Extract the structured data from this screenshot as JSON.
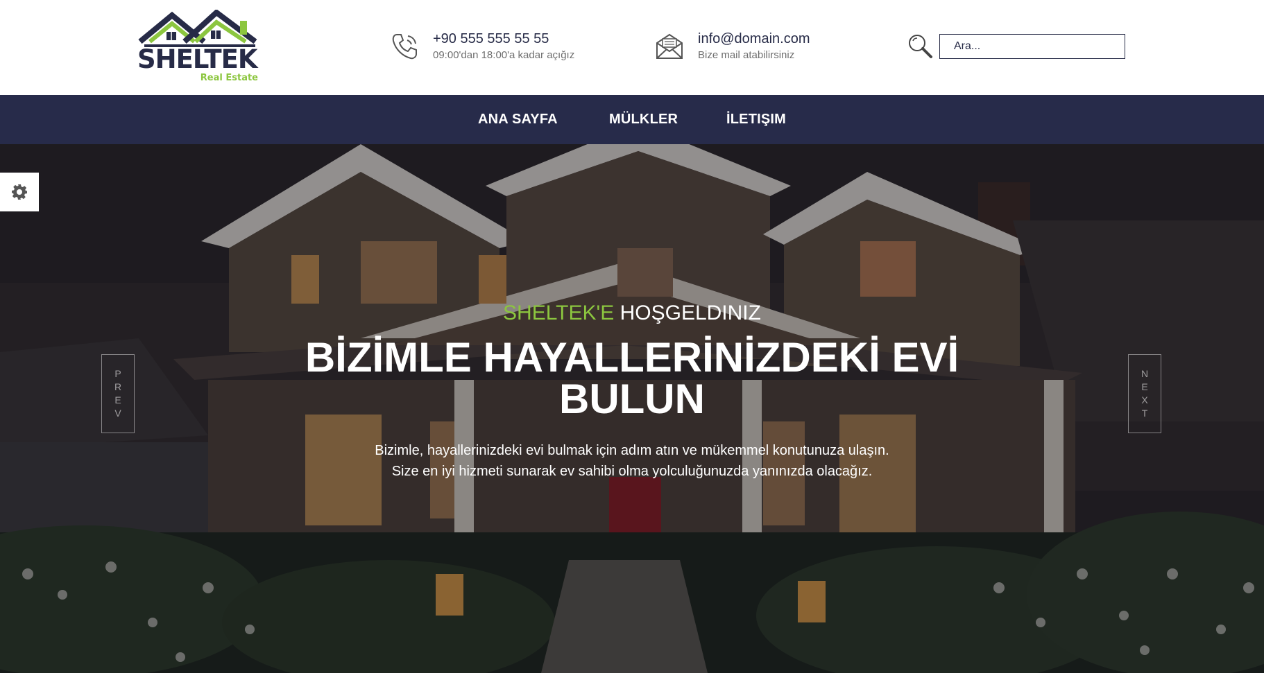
{
  "brand": {
    "name": "SHELTEK",
    "tagline": "Real Estate",
    "colors": {
      "navy": "#272b47",
      "green": "#8cc63f"
    }
  },
  "contact": {
    "phone": {
      "icon": "phone-icon",
      "value": "+90 555 555 55 55",
      "note": "09:00'dan 18:00'a kadar açığız"
    },
    "email": {
      "icon": "envelope-icon",
      "value": "info@domain.com",
      "note": "Bize mail atabilirsiniz"
    }
  },
  "search": {
    "icon": "search-icon",
    "placeholder": "Ara..."
  },
  "nav": {
    "items": [
      {
        "label": "ANA SAYFA"
      },
      {
        "label": "MÜLKLER"
      },
      {
        "label": "İLETIŞIM"
      }
    ]
  },
  "settings": {
    "icon": "gear-icon"
  },
  "hero": {
    "welcome_accent": "SHELTEK'E",
    "welcome_rest": "HOŞGELDINIZ",
    "title": "BİZİMLE HAYALLERİNİZDEKİ EVİ BULUN",
    "description_line1": "Bizimle, hayallerinizdeki evi bulmak için adım atın ve mükemmel konutunuza ulaşın.",
    "description_line2": "Size en iyi hizmeti sunarak ev sahibi olma yolculuğunuzda yanınızda olacağız.",
    "prev_letters": [
      "P",
      "R",
      "E",
      "V"
    ],
    "next_letters": [
      "N",
      "E",
      "X",
      "T"
    ]
  }
}
